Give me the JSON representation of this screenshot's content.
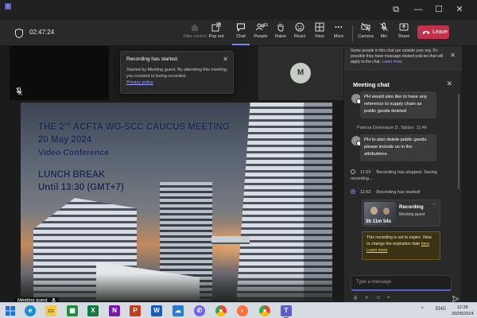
{
  "window": {
    "app_icon": "teams-icon",
    "controls": [
      "⧉",
      "—",
      "☐",
      "✕"
    ]
  },
  "toolbar": {
    "timer": "02:47:24",
    "buttons": {
      "take_control": "Take control",
      "pop_out": "Pop out",
      "chat": "Chat",
      "people": "People",
      "people_count": "15",
      "raise": "Raise",
      "react": "React",
      "view": "View",
      "more": "More",
      "camera": "Camera",
      "mic": "Mic",
      "share": "Share",
      "leave": "Leave"
    },
    "accent": "#7f85f5",
    "leave_color": "#c4314b"
  },
  "stage": {
    "participant_initial": "M",
    "toast": {
      "title": "Recording has started.",
      "body": "Started by Meeting guest. By attending this meeting, you consent to being recorded.",
      "link": "Privacy policy"
    },
    "slide": {
      "line1_prefix": "THE 2",
      "line1_sup": "nd",
      "line1_suffix": " ACFTA WG-SCC CAUCUS MEETING",
      "line2": "20 May 2024",
      "line3": "Video Conference",
      "line4": "LUNCH BREAK",
      "line5": "Until 13:30 (GMT+7)"
    },
    "presenter_name": "Meeting guest"
  },
  "chat": {
    "notice_text": "Some people in this chat are outside your org. It's possible they have message-related policies that will apply to the chat.",
    "notice_link": "Learn more",
    "title": "Meeting chat",
    "messages": [
      {
        "text": "PH would also like to have any reference to supply chain as public goods deleted"
      },
      {
        "sender": "Patricia Dominique D. Tablizo",
        "time": "11:46",
        "text": "PH to also delete public goods. please include us in the attributions."
      }
    ],
    "system": [
      {
        "time": "11:53",
        "text": "Recording has stopped. Saving recording..."
      },
      {
        "time": "11:53",
        "text": "Recording has started!"
      }
    ],
    "recording_card": {
      "duration": "3h 11m 54s",
      "title": "Recording",
      "subtitle": "Meeting guest",
      "more": "…"
    },
    "expire": {
      "text_before": "This recording is set to expire. View or change the expiration date ",
      "link_here": "here",
      "text_after": ".",
      "link_more": "Learn more"
    },
    "compose_placeholder": "Type a message"
  },
  "taskbar": {
    "apps": [
      "windows-start",
      "edge",
      "file-explorer",
      "excel-green",
      "excel",
      "onenote",
      "powerpoint",
      "word",
      "cloud-app",
      "viber",
      "chrome",
      "firefox",
      "chrome-alt",
      "teams"
    ],
    "tray_lang": "ENG",
    "time": "12:38",
    "date": "20/05/2024"
  }
}
